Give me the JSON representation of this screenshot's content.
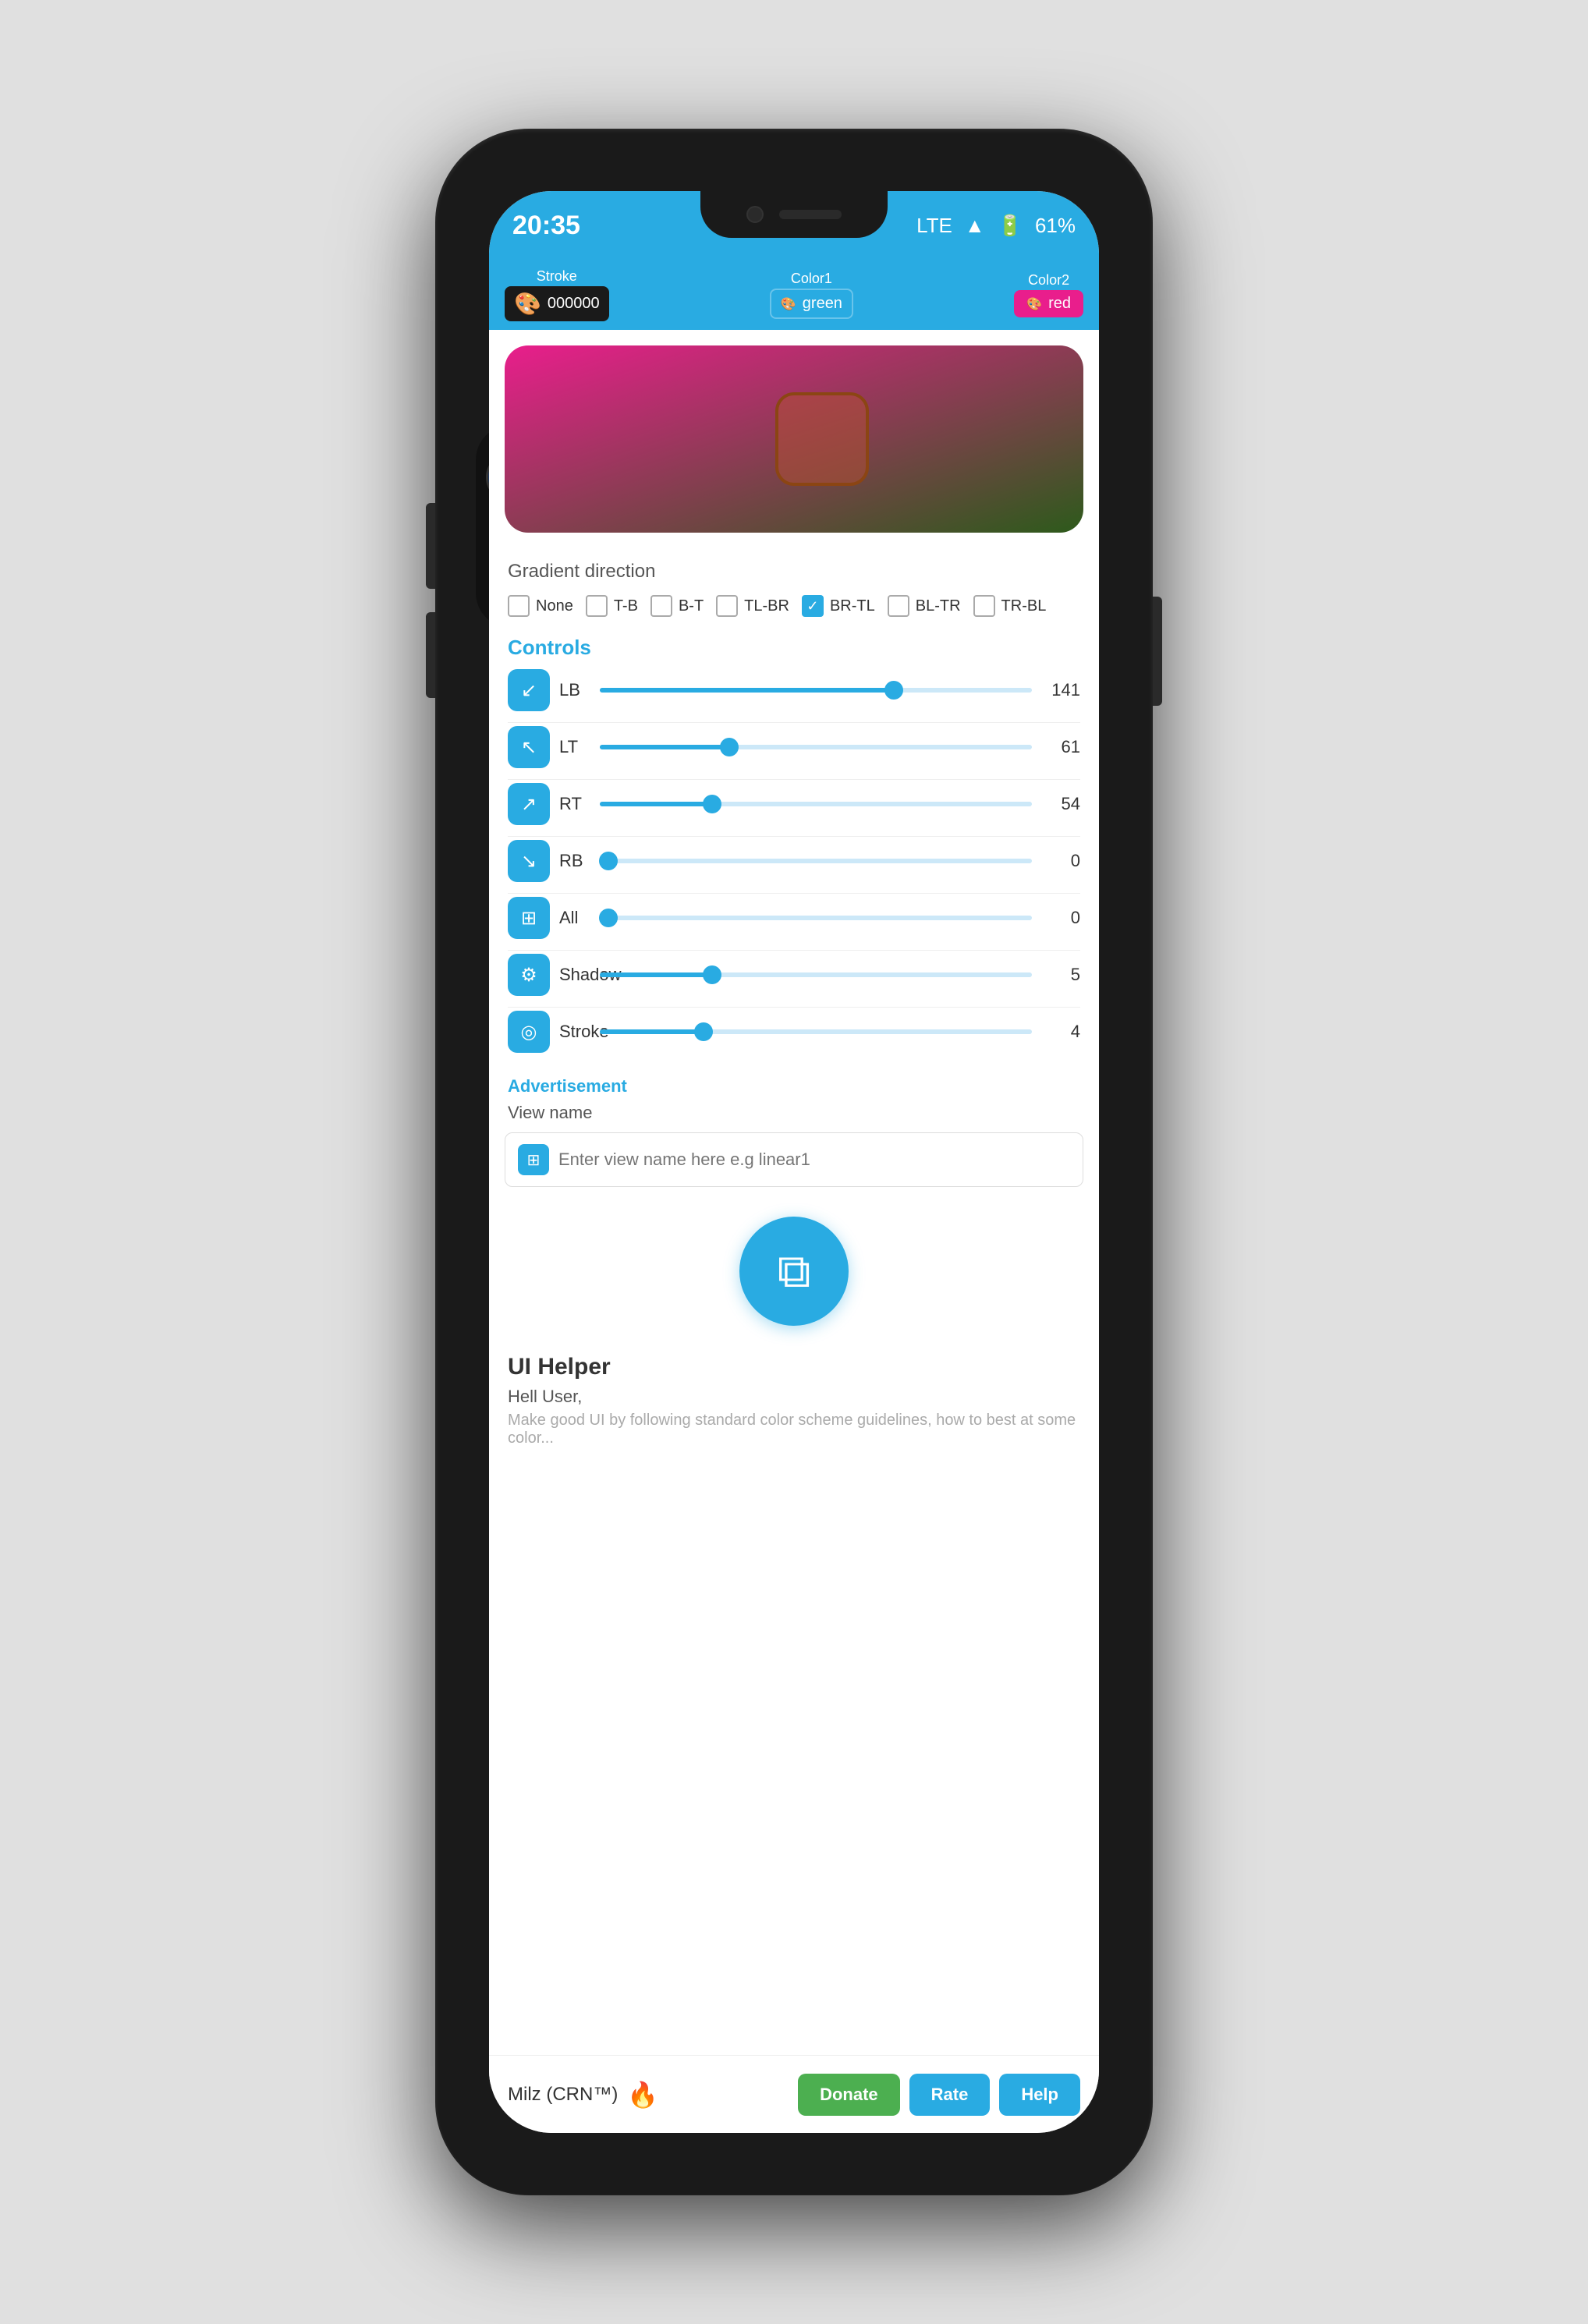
{
  "phone": {
    "status_bar": {
      "time": "20:35",
      "battery_percent": "61%",
      "signal": "LTE"
    },
    "toolbar": {
      "stroke_label": "Stroke",
      "color1_label": "Color1",
      "color2_label": "Color2",
      "stroke_value": "000000",
      "color1_value": "green",
      "color2_value": "red"
    },
    "gradient_direction": {
      "title": "Gradient direction",
      "options": [
        {
          "label": "None",
          "checked": false
        },
        {
          "label": "T-B",
          "checked": false
        },
        {
          "label": "B-T",
          "checked": false
        },
        {
          "label": "TL-BR",
          "checked": false
        },
        {
          "label": "BR-TL",
          "checked": true
        },
        {
          "label": "BL-TR",
          "checked": false
        },
        {
          "label": "TR-BL",
          "checked": false
        }
      ]
    },
    "controls": {
      "title": "Controls",
      "items": [
        {
          "id": "LB",
          "label": "LB",
          "value": 141,
          "percent": 68,
          "icon": "↙"
        },
        {
          "id": "LT",
          "label": "LT",
          "value": 61,
          "percent": 30,
          "icon": "↖"
        },
        {
          "id": "RT",
          "label": "RT",
          "value": 54,
          "percent": 26,
          "icon": "↗"
        },
        {
          "id": "RB",
          "label": "RB",
          "value": 0,
          "percent": 2,
          "icon": "↘"
        },
        {
          "id": "All",
          "label": "All",
          "value": 0,
          "percent": 2,
          "icon": "⊞"
        }
      ],
      "shadow": {
        "label": "Shadow",
        "value": 5,
        "percent": 26
      },
      "stroke": {
        "label": "Stroke",
        "value": 4,
        "percent": 24
      }
    },
    "advertisement": {
      "label": "Advertisement"
    },
    "view_name": {
      "label": "View name",
      "placeholder": "Enter view name here e.g linear1"
    },
    "ui_helper": {
      "title": "UI Helper",
      "greeting": "Hell User,",
      "description": "Make good UI by following standard color scheme guidelines, how to best at some color..."
    },
    "bottom_bar": {
      "author": "Milz (CRN™)",
      "donate_label": "Donate",
      "rate_label": "Rate",
      "help_label": "Help"
    }
  }
}
